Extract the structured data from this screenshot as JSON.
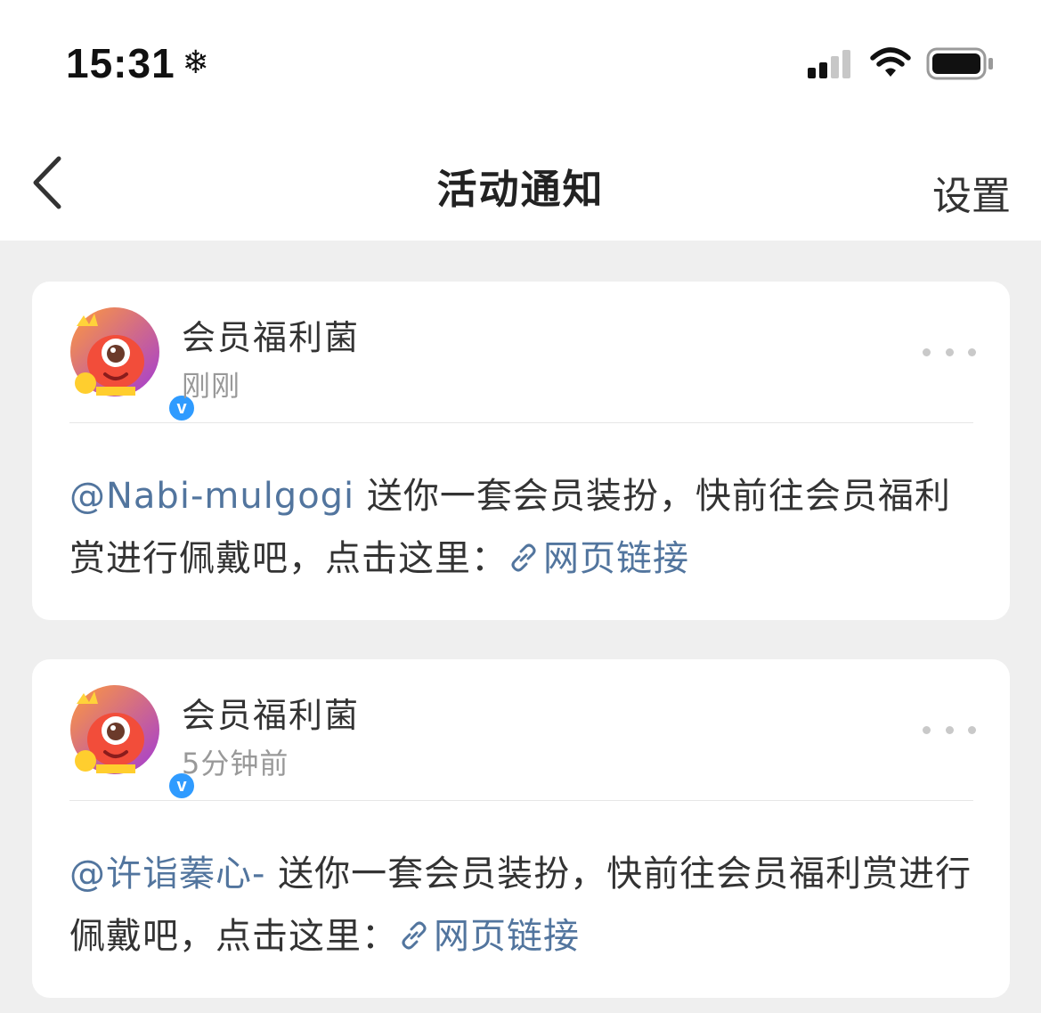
{
  "status_bar": {
    "time": "15:31",
    "weather_icon": "snowflake-icon",
    "signal_icon": "cellular-signal-icon",
    "wifi_icon": "wifi-icon",
    "battery_icon": "battery-icon"
  },
  "nav": {
    "back_icon": "chevron-left-icon",
    "title": "活动通知",
    "settings_label": "设置"
  },
  "notifications": [
    {
      "sender": "会员福利菌",
      "time_ago": "刚刚",
      "verified_label": "v",
      "mention": "@Nabi-mulgogi",
      "message": " 送你一套会员装扮，快前往会员福利赏进行佩戴吧，点击这里：",
      "link_label": "网页链接"
    },
    {
      "sender": "会员福利菌",
      "time_ago": "5分钟前",
      "verified_label": "v",
      "mention": "@许诣蓁心-",
      "message": " 送你一套会员装扮，快前往会员福利赏进行佩戴吧，点击这里：",
      "link_label": "网页链接"
    }
  ],
  "colors": {
    "background": "#efefef",
    "card": "#ffffff",
    "link": "#52759e",
    "verified_badge": "#2f9bff",
    "secondary_text": "#999999"
  }
}
